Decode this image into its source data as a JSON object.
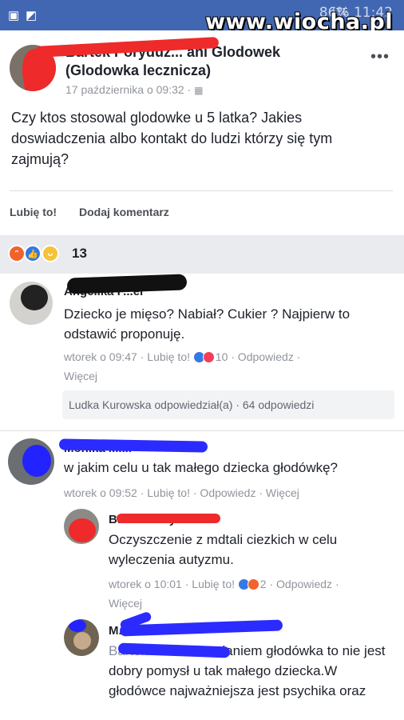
{
  "status_bar": {
    "network": "LTE",
    "battery": "86%",
    "time": "11:42",
    "watermark": "www.wiocha.pl"
  },
  "post": {
    "author_line1": "Bartek Poryduz... ani Glodowek",
    "author_line2": "(Glodowka lecznicza)",
    "timestamp": "17 października o 09:32 ·",
    "text": "Czy ktos stosowal glodowke u 5 latka? Jakies doswiadczenia albo kontakt do ludzi którzy się tym zajmują?",
    "like_label": "Lubię to!",
    "comment_label": "Dodaj komentarz",
    "more_label": "•••"
  },
  "reactions": {
    "count": "13",
    "icons": [
      "angry-icon",
      "like-icon",
      "haha-icon"
    ]
  },
  "comments": [
    {
      "author": "Angelika F...er",
      "text": "Dziecko je mięso? Nabiał? Cukier ? Najpierw to odstawić proponuję.",
      "meta_time": "wtorek o 09:47 ·",
      "meta_like": "Lubię to!",
      "meta_count": "10",
      "meta_reply": "· Odpowiedz ·",
      "meta_more": "Więcej",
      "replies_summary": "Ludka Kurowska odpowiedział(a) · 64 odpowiedzi"
    },
    {
      "author": "Monika Mi...",
      "text": "w jakim celu u tak małego dziecka głodówkę?",
      "meta": "wtorek o 09:52 · Lubię to! · Odpowiedz · Więcej"
    },
    {
      "author": "Bartek Poryduz...",
      "text": "Oczyszczenie z mdtali ciezkich w celu wyleczenia autyzmu.",
      "meta_time": "wtorek o 10:01 ·",
      "meta_like": "Lubię to!",
      "meta_count": "2",
      "meta_reply": "· Odpowiedz ·",
      "meta_more": "Więcej"
    },
    {
      "author": "M...",
      "text_prefix": "Bartek P...",
      "text": "Moim zdaniem głodówka to nie jest dobry pomysł u tak małego dziecka.W głodówce najważniejsza jest psychika oraz"
    }
  ]
}
